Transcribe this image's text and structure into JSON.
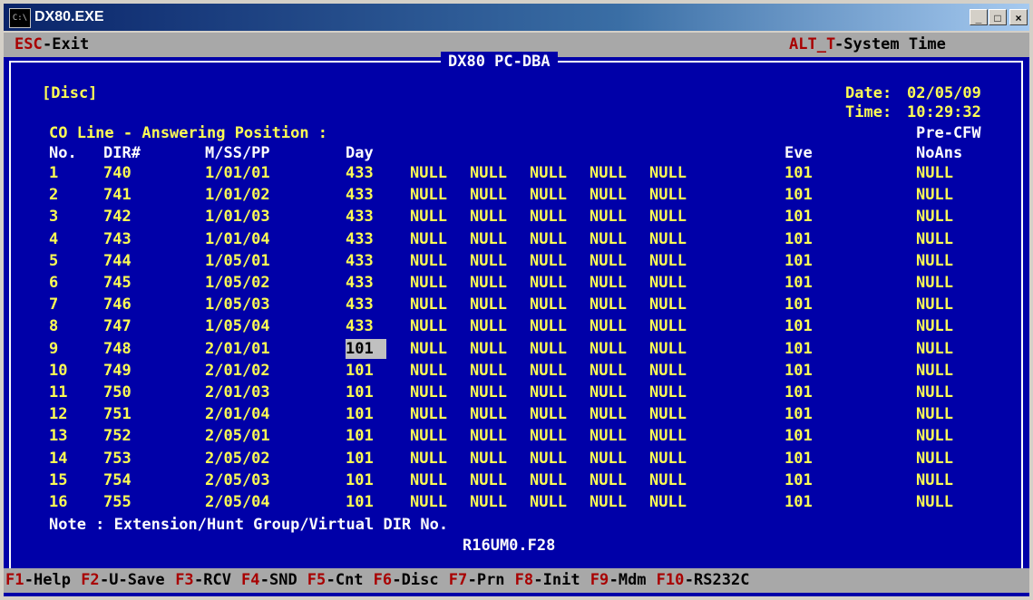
{
  "window": {
    "title": "DX80.EXE",
    "icon_label": "C:\\"
  },
  "top_bar": {
    "esc_key": "ESC",
    "esc_label": "-Exit",
    "alt_key": "ALT_T",
    "alt_label": "-System Time"
  },
  "header": {
    "app_title": "DX80 PC-DBA",
    "mode": "[Disc]",
    "date_label": "Date:",
    "date_value": "02/05/09",
    "time_label": "Time:",
    "time_value": "10:29:32",
    "section": "CO Line - Answering Position :",
    "pre_cfw": "Pre-CFW"
  },
  "columns": {
    "no": "No.",
    "dir": "DIR#",
    "mssp": "M/SS/PP",
    "day": "Day",
    "eve": "Eve",
    "noans": "NoAns"
  },
  "rows": [
    {
      "no": "1",
      "dir": "740",
      "mssp": "1/01/01",
      "day": "433",
      "n1": "NULL",
      "n2": "NULL",
      "n3": "NULL",
      "n4": "NULL",
      "n5": "NULL",
      "eve": "101",
      "noans": "NULL"
    },
    {
      "no": "2",
      "dir": "741",
      "mssp": "1/01/02",
      "day": "433",
      "n1": "NULL",
      "n2": "NULL",
      "n3": "NULL",
      "n4": "NULL",
      "n5": "NULL",
      "eve": "101",
      "noans": "NULL"
    },
    {
      "no": "3",
      "dir": "742",
      "mssp": "1/01/03",
      "day": "433",
      "n1": "NULL",
      "n2": "NULL",
      "n3": "NULL",
      "n4": "NULL",
      "n5": "NULL",
      "eve": "101",
      "noans": "NULL"
    },
    {
      "no": "4",
      "dir": "743",
      "mssp": "1/01/04",
      "day": "433",
      "n1": "NULL",
      "n2": "NULL",
      "n3": "NULL",
      "n4": "NULL",
      "n5": "NULL",
      "eve": "101",
      "noans": "NULL"
    },
    {
      "no": "5",
      "dir": "744",
      "mssp": "1/05/01",
      "day": "433",
      "n1": "NULL",
      "n2": "NULL",
      "n3": "NULL",
      "n4": "NULL",
      "n5": "NULL",
      "eve": "101",
      "noans": "NULL"
    },
    {
      "no": "6",
      "dir": "745",
      "mssp": "1/05/02",
      "day": "433",
      "n1": "NULL",
      "n2": "NULL",
      "n3": "NULL",
      "n4": "NULL",
      "n5": "NULL",
      "eve": "101",
      "noans": "NULL"
    },
    {
      "no": "7",
      "dir": "746",
      "mssp": "1/05/03",
      "day": "433",
      "n1": "NULL",
      "n2": "NULL",
      "n3": "NULL",
      "n4": "NULL",
      "n5": "NULL",
      "eve": "101",
      "noans": "NULL"
    },
    {
      "no": "8",
      "dir": "747",
      "mssp": "1/05/04",
      "day": "433",
      "n1": "NULL",
      "n2": "NULL",
      "n3": "NULL",
      "n4": "NULL",
      "n5": "NULL",
      "eve": "101",
      "noans": "NULL"
    },
    {
      "no": "9",
      "dir": "748",
      "mssp": "2/01/01",
      "day": "101",
      "n1": "NULL",
      "n2": "NULL",
      "n3": "NULL",
      "n4": "NULL",
      "n5": "NULL",
      "eve": "101",
      "noans": "NULL",
      "selected": true
    },
    {
      "no": "10",
      "dir": "749",
      "mssp": "2/01/02",
      "day": "101",
      "n1": "NULL",
      "n2": "NULL",
      "n3": "NULL",
      "n4": "NULL",
      "n5": "NULL",
      "eve": "101",
      "noans": "NULL"
    },
    {
      "no": "11",
      "dir": "750",
      "mssp": "2/01/03",
      "day": "101",
      "n1": "NULL",
      "n2": "NULL",
      "n3": "NULL",
      "n4": "NULL",
      "n5": "NULL",
      "eve": "101",
      "noans": "NULL"
    },
    {
      "no": "12",
      "dir": "751",
      "mssp": "2/01/04",
      "day": "101",
      "n1": "NULL",
      "n2": "NULL",
      "n3": "NULL",
      "n4": "NULL",
      "n5": "NULL",
      "eve": "101",
      "noans": "NULL"
    },
    {
      "no": "13",
      "dir": "752",
      "mssp": "2/05/01",
      "day": "101",
      "n1": "NULL",
      "n2": "NULL",
      "n3": "NULL",
      "n4": "NULL",
      "n5": "NULL",
      "eve": "101",
      "noans": "NULL"
    },
    {
      "no": "14",
      "dir": "753",
      "mssp": "2/05/02",
      "day": "101",
      "n1": "NULL",
      "n2": "NULL",
      "n3": "NULL",
      "n4": "NULL",
      "n5": "NULL",
      "eve": "101",
      "noans": "NULL"
    },
    {
      "no": "15",
      "dir": "754",
      "mssp": "2/05/03",
      "day": "101",
      "n1": "NULL",
      "n2": "NULL",
      "n3": "NULL",
      "n4": "NULL",
      "n5": "NULL",
      "eve": "101",
      "noans": "NULL"
    },
    {
      "no": "16",
      "dir": "755",
      "mssp": "2/05/04",
      "day": "101",
      "n1": "NULL",
      "n2": "NULL",
      "n3": "NULL",
      "n4": "NULL",
      "n5": "NULL",
      "eve": "101",
      "noans": "NULL"
    }
  ],
  "note": "Note : Extension/Hunt Group/Virtual DIR No.",
  "footer_file": "R16UM0.F28",
  "function_keys": [
    {
      "key": "F1",
      "label": "-Help"
    },
    {
      "key": "F2",
      "label": "-U-Save"
    },
    {
      "key": "F3",
      "label": "-RCV"
    },
    {
      "key": "F4",
      "label": "-SND"
    },
    {
      "key": "F5",
      "label": "-Cnt"
    },
    {
      "key": "F6",
      "label": "-Disc"
    },
    {
      "key": "F7",
      "label": "-Prn"
    },
    {
      "key": "F8",
      "label": "-Init"
    },
    {
      "key": "F9",
      "label": "-Mdm"
    },
    {
      "key": "F10",
      "label": "-RS232C"
    }
  ],
  "colors": {
    "background": "#0000a8",
    "text_yellow": "#fcfc54",
    "text_white": "#fcfcfc",
    "bar_gray": "#a8a8a8",
    "key_red": "#a80000"
  }
}
